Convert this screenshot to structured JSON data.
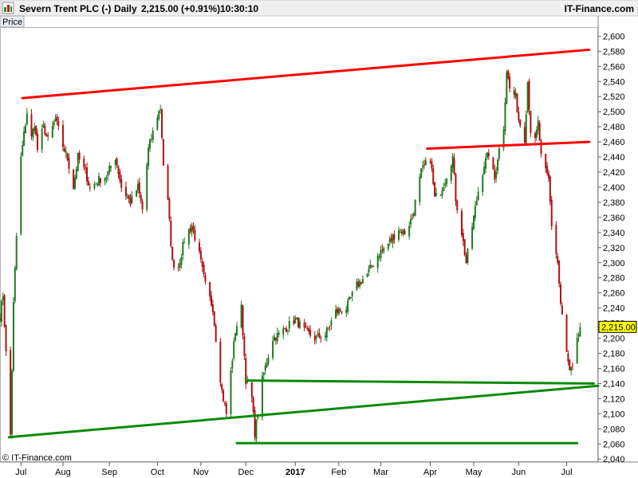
{
  "header": {
    "instrument": "Severn Trent PLC (-)",
    "period": "Daily",
    "quote": "2,215.00 (+0.91%)",
    "time": "10:30:10",
    "brand": "IT-Finance.com"
  },
  "footer": {
    "copyright": "© IT-Finance.com"
  },
  "price_tab": "Price",
  "colors": {
    "up": "#1f7a1f",
    "down": "#b01010",
    "resistance": "#ff0000",
    "support": "#0a8a0a",
    "last_badge": "#ffff00"
  },
  "chart_data": {
    "type": "candlestick",
    "ylim": [
      2036,
      2612
    ],
    "y_ticks": [
      {
        "v": 2040,
        "label": "2,040"
      },
      {
        "v": 2060,
        "label": "2,060"
      },
      {
        "v": 2080,
        "label": "2,080"
      },
      {
        "v": 2100,
        "label": "2,100"
      },
      {
        "v": 2120,
        "label": "2,120"
      },
      {
        "v": 2140,
        "label": "2,140"
      },
      {
        "v": 2160,
        "label": "2,160"
      },
      {
        "v": 2180,
        "label": "2,180"
      },
      {
        "v": 2200,
        "label": "2,200"
      },
      {
        "v": 2220,
        "label": "2,220"
      },
      {
        "v": 2240,
        "label": "2,240"
      },
      {
        "v": 2260,
        "label": "2,260"
      },
      {
        "v": 2280,
        "label": "2,280"
      },
      {
        "v": 2300,
        "label": "2,300"
      },
      {
        "v": 2320,
        "label": "2,320"
      },
      {
        "v": 2340,
        "label": "2,340"
      },
      {
        "v": 2360,
        "label": "2,360"
      },
      {
        "v": 2380,
        "label": "2,380"
      },
      {
        "v": 2400,
        "label": "2,400"
      },
      {
        "v": 2420,
        "label": "2,420"
      },
      {
        "v": 2440,
        "label": "2,440"
      },
      {
        "v": 2460,
        "label": "2,460"
      },
      {
        "v": 2480,
        "label": "2,480"
      },
      {
        "v": 2500,
        "label": "2,500"
      },
      {
        "v": 2520,
        "label": "2,520"
      },
      {
        "v": 2540,
        "label": "2,540"
      },
      {
        "v": 2560,
        "label": "2,560"
      },
      {
        "v": 2580,
        "label": "2,580"
      },
      {
        "v": 2600,
        "label": "2,600"
      }
    ],
    "x_range": [
      "2016-06-20",
      "2017-07-24"
    ],
    "x_ticks": [
      {
        "date": "2016-07-04",
        "label": "Jul"
      },
      {
        "date": "2016-08-01",
        "label": "Aug"
      },
      {
        "date": "2016-09-01",
        "label": "Sep"
      },
      {
        "date": "2016-10-03",
        "label": "Oct"
      },
      {
        "date": "2016-11-01",
        "label": "Nov"
      },
      {
        "date": "2016-12-01",
        "label": "Dec"
      },
      {
        "date": "2017-01-03",
        "label": "2017",
        "bold": true
      },
      {
        "date": "2017-02-01",
        "label": "Feb"
      },
      {
        "date": "2017-03-01",
        "label": "Mar"
      },
      {
        "date": "2017-04-03",
        "label": "Apr"
      },
      {
        "date": "2017-05-02",
        "label": "May"
      },
      {
        "date": "2017-06-01",
        "label": "Jun"
      },
      {
        "date": "2017-07-03",
        "label": "Jul"
      }
    ],
    "last_price": {
      "value": 2215,
      "label": "2,215.00"
    },
    "price_path": [
      [
        "2016-06-20",
        2230
      ],
      [
        "2016-06-22",
        2258
      ],
      [
        "2016-06-24",
        2180
      ],
      [
        "2016-06-27",
        2072
      ],
      [
        "2016-06-29",
        2245
      ],
      [
        "2016-07-01",
        2335
      ],
      [
        "2016-07-04",
        2438
      ],
      [
        "2016-07-06",
        2470
      ],
      [
        "2016-07-08",
        2500
      ],
      [
        "2016-07-11",
        2465
      ],
      [
        "2016-07-13",
        2485
      ],
      [
        "2016-07-15",
        2450
      ],
      [
        "2016-07-19",
        2480
      ],
      [
        "2016-07-22",
        2462
      ],
      [
        "2016-07-27",
        2490
      ],
      [
        "2016-08-01",
        2455
      ],
      [
        "2016-08-04",
        2438
      ],
      [
        "2016-08-08",
        2400
      ],
      [
        "2016-08-11",
        2440
      ],
      [
        "2016-08-16",
        2420
      ],
      [
        "2016-08-19",
        2398
      ],
      [
        "2016-08-25",
        2410
      ],
      [
        "2016-08-30",
        2415
      ],
      [
        "2016-09-05",
        2440
      ],
      [
        "2016-09-09",
        2400
      ],
      [
        "2016-09-15",
        2380
      ],
      [
        "2016-09-20",
        2400
      ],
      [
        "2016-09-23",
        2370
      ],
      [
        "2016-09-27",
        2450
      ],
      [
        "2016-10-03",
        2495
      ],
      [
        "2016-10-05",
        2505
      ],
      [
        "2016-10-07",
        2430
      ],
      [
        "2016-10-10",
        2380
      ],
      [
        "2016-10-13",
        2300
      ],
      [
        "2016-10-17",
        2295
      ],
      [
        "2016-10-21",
        2330
      ],
      [
        "2016-10-26",
        2350
      ],
      [
        "2016-10-31",
        2310
      ],
      [
        "2016-11-04",
        2270
      ],
      [
        "2016-11-09",
        2240
      ],
      [
        "2016-11-11",
        2200
      ],
      [
        "2016-11-15",
        2130
      ],
      [
        "2016-11-18",
        2100
      ],
      [
        "2016-11-21",
        2155
      ],
      [
        "2016-11-24",
        2210
      ],
      [
        "2016-11-28",
        2240
      ],
      [
        "2016-12-01",
        2145
      ],
      [
        "2016-12-05",
        2120
      ],
      [
        "2016-12-07",
        2075
      ],
      [
        "2016-12-09",
        2100
      ],
      [
        "2016-12-12",
        2145
      ],
      [
        "2016-12-15",
        2170
      ],
      [
        "2016-12-19",
        2200
      ],
      [
        "2016-12-23",
        2205
      ],
      [
        "2017-01-03",
        2225
      ],
      [
        "2017-01-09",
        2210
      ],
      [
        "2017-01-16",
        2200
      ],
      [
        "2017-01-23",
        2205
      ],
      [
        "2017-01-30",
        2235
      ],
      [
        "2017-02-06",
        2240
      ],
      [
        "2017-02-13",
        2270
      ],
      [
        "2017-02-20",
        2285
      ],
      [
        "2017-02-27",
        2310
      ],
      [
        "2017-03-06",
        2325
      ],
      [
        "2017-03-13",
        2345
      ],
      [
        "2017-03-17",
        2340
      ],
      [
        "2017-03-22",
        2360
      ],
      [
        "2017-03-28",
        2420
      ],
      [
        "2017-04-03",
        2440
      ],
      [
        "2017-04-06",
        2385
      ],
      [
        "2017-04-10",
        2395
      ],
      [
        "2017-04-13",
        2410
      ],
      [
        "2017-04-18",
        2440
      ],
      [
        "2017-04-20",
        2385
      ],
      [
        "2017-04-24",
        2340
      ],
      [
        "2017-04-27",
        2300
      ],
      [
        "2017-05-02",
        2360
      ],
      [
        "2017-05-05",
        2395
      ],
      [
        "2017-05-09",
        2430
      ],
      [
        "2017-05-12",
        2445
      ],
      [
        "2017-05-16",
        2410
      ],
      [
        "2017-05-18",
        2440
      ],
      [
        "2017-05-22",
        2480
      ],
      [
        "2017-05-24",
        2555
      ],
      [
        "2017-05-26",
        2530
      ],
      [
        "2017-05-30",
        2520
      ],
      [
        "2017-06-01",
        2490
      ],
      [
        "2017-06-05",
        2465
      ],
      [
        "2017-06-07",
        2540
      ],
      [
        "2017-06-09",
        2475
      ],
      [
        "2017-06-12",
        2460
      ],
      [
        "2017-06-14",
        2485
      ],
      [
        "2017-06-16",
        2440
      ],
      [
        "2017-06-19",
        2420
      ],
      [
        "2017-06-21",
        2410
      ],
      [
        "2017-06-23",
        2350
      ],
      [
        "2017-06-27",
        2300
      ],
      [
        "2017-06-29",
        2245
      ],
      [
        "2017-07-03",
        2180
      ],
      [
        "2017-07-05",
        2155
      ],
      [
        "2017-07-07",
        2160
      ],
      [
        "2017-07-10",
        2195
      ],
      [
        "2017-07-12",
        2215
      ]
    ],
    "trendlines": [
      {
        "role": "resistance",
        "from": [
          "2016-07-05",
          2518
        ],
        "to": [
          "2017-07-18",
          2582
        ]
      },
      {
        "role": "resistance",
        "from": [
          "2017-04-01",
          2451
        ],
        "to": [
          "2017-07-18",
          2460
        ]
      },
      {
        "role": "support",
        "from": [
          "2016-06-26",
          2069
        ],
        "to": [
          "2017-07-24",
          2137
        ]
      },
      {
        "role": "support",
        "from": [
          "2016-12-01",
          2144
        ],
        "to": [
          "2017-07-21",
          2140
        ]
      },
      {
        "role": "support",
        "from": [
          "2016-11-25",
          2061
        ],
        "to": [
          "2017-07-10",
          2061
        ]
      }
    ]
  }
}
